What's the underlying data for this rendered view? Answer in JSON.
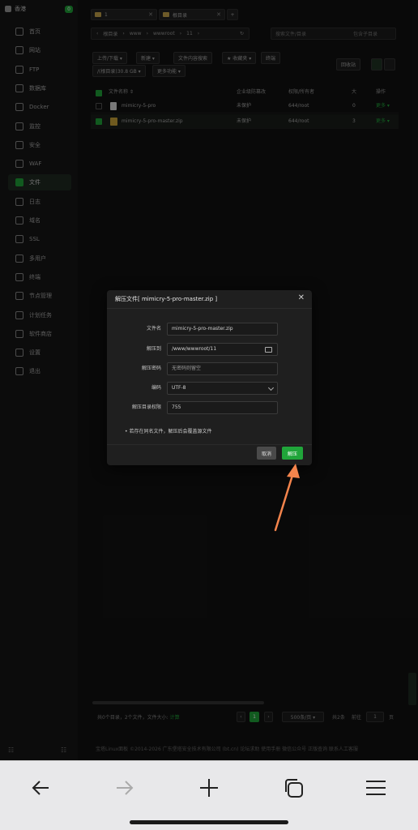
{
  "sidebar": {
    "server_name": "香港",
    "badge": "0",
    "items": [
      "首页",
      "网站",
      "FTP",
      "数据库",
      "Docker",
      "监控",
      "安全",
      "WAF",
      "文件",
      "日志",
      "域名",
      "SSL",
      "多用户",
      "终端",
      "节点管理",
      "计划任务",
      "软件商店",
      "设置",
      "退出"
    ],
    "active_item": "文件",
    "footer_left": "☷",
    "footer_right": "☷"
  },
  "main": {
    "tabs": [
      {
        "label": "1",
        "close": "✕"
      },
      {
        "label": "根目录",
        "close": "✕"
      },
      {
        "label": "+",
        "close": ""
      }
    ],
    "path": {
      "back": "‹",
      "segments": [
        "根目录",
        "›",
        "www",
        "›",
        "wwwroot",
        "›",
        "11",
        "›"
      ],
      "refresh": "↻"
    },
    "search": {
      "placeholder": "搜索文件/目录",
      "option": "包含子目录"
    },
    "toolbar": {
      "upload": "上传/下载 ▾",
      "new": "新建 ▾",
      "content_search": "文件内容搜索",
      "favorites": "★ 收藏夹 ▾",
      "terminal": "终端",
      "disk": "/(根目录)30.8 GB ▾",
      "more": "更多功能 ▾",
      "recycle": "回收站"
    },
    "table": {
      "headers": [
        "文件名称 ⇕",
        "企业级防篡改",
        "权限/所有者",
        "大",
        "操作"
      ],
      "rows": [
        {
          "name": "mimicry-5-pro",
          "protect": "未保护",
          "perm": "644/root",
          "size": "0",
          "op": "更多 ▾",
          "selected": false
        },
        {
          "name": "mimicry-5-pro-master.zip",
          "protect": "未保护",
          "perm": "644/root",
          "size": "3",
          "op": "更多 ▾",
          "selected": true
        }
      ]
    },
    "footer": {
      "stat": "共0个目录，2个文件，文件大小:",
      "calc": "计算",
      "page": "1",
      "per_page": "500条/页 ▾",
      "total": "共2条",
      "goto_label": "前往",
      "goto_value": "1",
      "goto_suffix": "页"
    },
    "copyright": "宝塔Linux面板 ©2014-2026 广东堡塔安全技术有限公司 (bt.cn)   论坛求助   使用手册   微信公众号   正版查询   联系人工客服"
  },
  "modal": {
    "title": "解压文件[ mimicry-5-pro-master.zip ]",
    "close": "✕",
    "fields": {
      "filename_label": "文件名",
      "filename_value": "mimicry-5-pro-master.zip",
      "extract_to_label": "解压到",
      "extract_to_value": "/www/wwwroot/11",
      "password_label": "解压密码",
      "password_placeholder": "无密码则留空",
      "encoding_label": "编码",
      "encoding_value": "UTF-8",
      "permission_label": "解压目录权限",
      "permission_value": "755"
    },
    "note": "• 若存在同名文件，解压后会覆盖源文件",
    "cancel": "取消",
    "confirm": "解压"
  },
  "browser": {
    "back": "back-arrow-icon",
    "forward": "forward-arrow-icon",
    "new_tab": "plus-icon",
    "tabs": "tabs-icon",
    "menu": "menu-icon"
  },
  "colors": {
    "accent": "#20a53a",
    "annotation_arrow": "#f4844c"
  }
}
